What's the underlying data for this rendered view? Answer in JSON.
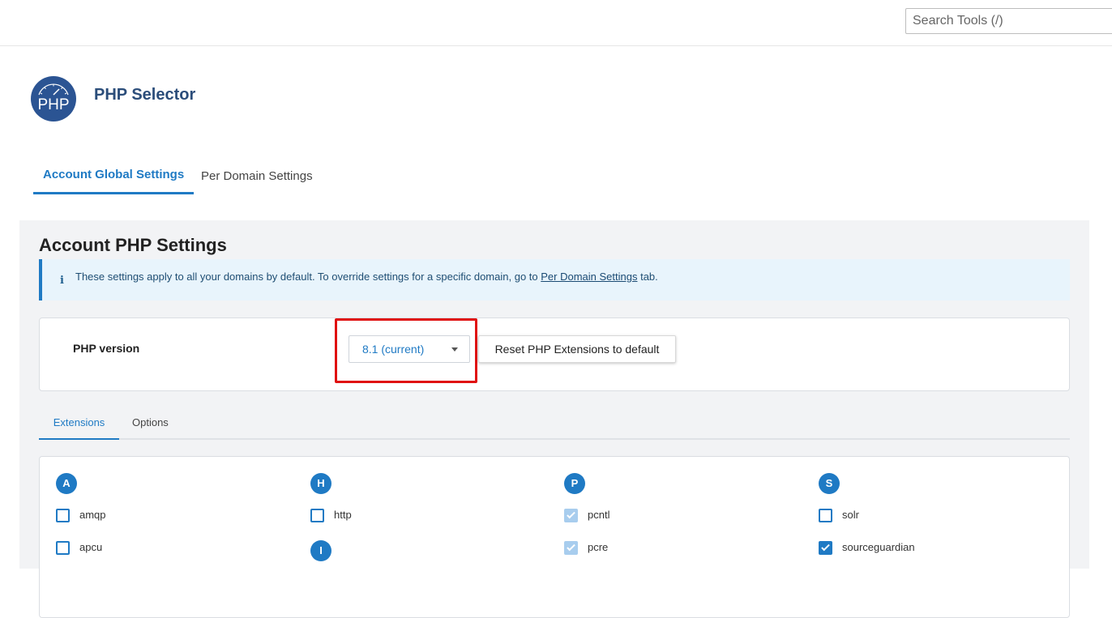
{
  "search": {
    "placeholder": "Search Tools (/)"
  },
  "header": {
    "logo_text": "PHP",
    "title": "PHP Selector"
  },
  "main_tabs": [
    {
      "label": "Account Global Settings"
    },
    {
      "label": "Per Domain Settings"
    }
  ],
  "section": {
    "title": "Account PHP Settings"
  },
  "info": {
    "icon": "i",
    "text_before": "These settings apply to all your domains by default. To override settings for a specific domain, go to ",
    "link": "Per Domain Settings",
    "text_after": " tab."
  },
  "php_version": {
    "label": "PHP version",
    "selected": "8.1 (current)",
    "reset_button": "Reset PHP Extensions to default"
  },
  "sub_tabs": [
    {
      "label": "Extensions"
    },
    {
      "label": "Options"
    }
  ],
  "extensions": {
    "groups": [
      {
        "letter": "A",
        "items": [
          {
            "name": "amqp",
            "state": "unchecked"
          },
          {
            "name": "apcu",
            "state": "unchecked"
          }
        ]
      },
      {
        "letter": "H",
        "items": [
          {
            "name": "http",
            "state": "unchecked"
          }
        ]
      },
      {
        "letter": "I",
        "items": []
      },
      {
        "letter": "P",
        "items": [
          {
            "name": "pcntl",
            "state": "checked-disabled"
          },
          {
            "name": "pcre",
            "state": "checked-disabled"
          }
        ]
      },
      {
        "letter": "S",
        "items": [
          {
            "name": "solr",
            "state": "unchecked"
          },
          {
            "name": "sourceguardian",
            "state": "checked"
          }
        ]
      }
    ]
  },
  "colors": {
    "accent": "#1f7ac4",
    "highlight": "#e01010",
    "title": "#2b4d7a"
  }
}
